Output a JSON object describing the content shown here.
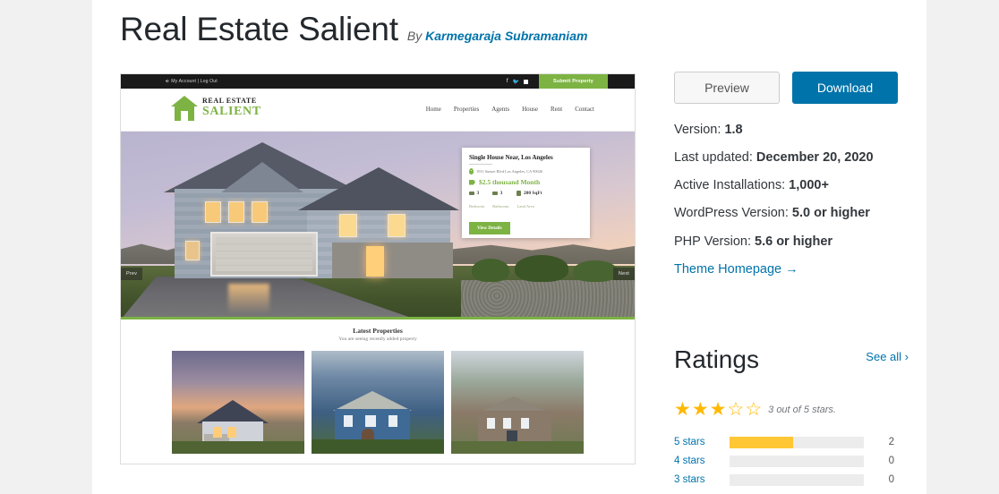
{
  "header": {
    "theme_title": "Real Estate Salient",
    "by_label": "By",
    "author": "Karmegaraja Subramaniam"
  },
  "actions": {
    "preview_label": "Preview",
    "download_label": "Download"
  },
  "meta": [
    {
      "label": "Version:",
      "value": "1.8"
    },
    {
      "label": "Last updated:",
      "value": "December 20, 2020"
    },
    {
      "label": "Active Installations:",
      "value": "1,000+"
    },
    {
      "label": "WordPress Version:",
      "value": "5.0 or higher"
    },
    {
      "label": "PHP Version:",
      "value": "5.6 or higher"
    }
  ],
  "homepage_link": "Theme Homepage  →",
  "ratings": {
    "title": "Ratings",
    "see_all": "See all  ›",
    "stars_filled": 3,
    "stars_total": 5,
    "summary": "3 out of 5 stars.",
    "star_glyph_filled": "★",
    "star_glyph_empty": "☆",
    "accent_color": "#ffb900",
    "bar_fill_color": "#ffc733",
    "rows": [
      {
        "label": "5 stars",
        "count": "2",
        "percent": 47
      },
      {
        "label": "4 stars",
        "count": "0",
        "percent": 0
      },
      {
        "label": "3 stars",
        "count": "0",
        "percent": 0
      }
    ]
  },
  "screenshot": {
    "topbar": {
      "account": "My Account | Log Out",
      "social": [
        "facebook-icon",
        "twitter-icon",
        "linkedin-icon"
      ],
      "submit_label": "Submit Property"
    },
    "logo": {
      "line1": "REAL ESTATE",
      "line2": "SALIENT"
    },
    "nav": [
      "Home",
      "Properties",
      "Agents",
      "House",
      "Rent",
      "Contact"
    ],
    "slider": {
      "prev": "Prev",
      "next": "Next"
    },
    "property_card": {
      "title": "Single House Near, Los Angeles",
      "address": "1911 Sunset Blvd Los Angeles, CA 90026",
      "price": "$2.5 thousand Month",
      "stats": [
        {
          "value": "3",
          "label": "Bedroom"
        },
        {
          "value": "3",
          "label": "Bathroom"
        },
        {
          "value": "200 SqFt",
          "label": "Land Area"
        }
      ],
      "button": "View Details"
    },
    "latest": {
      "heading": "Latest Properties",
      "subheading": "You are seeing recently added property"
    },
    "brand_green": "#7db343"
  }
}
